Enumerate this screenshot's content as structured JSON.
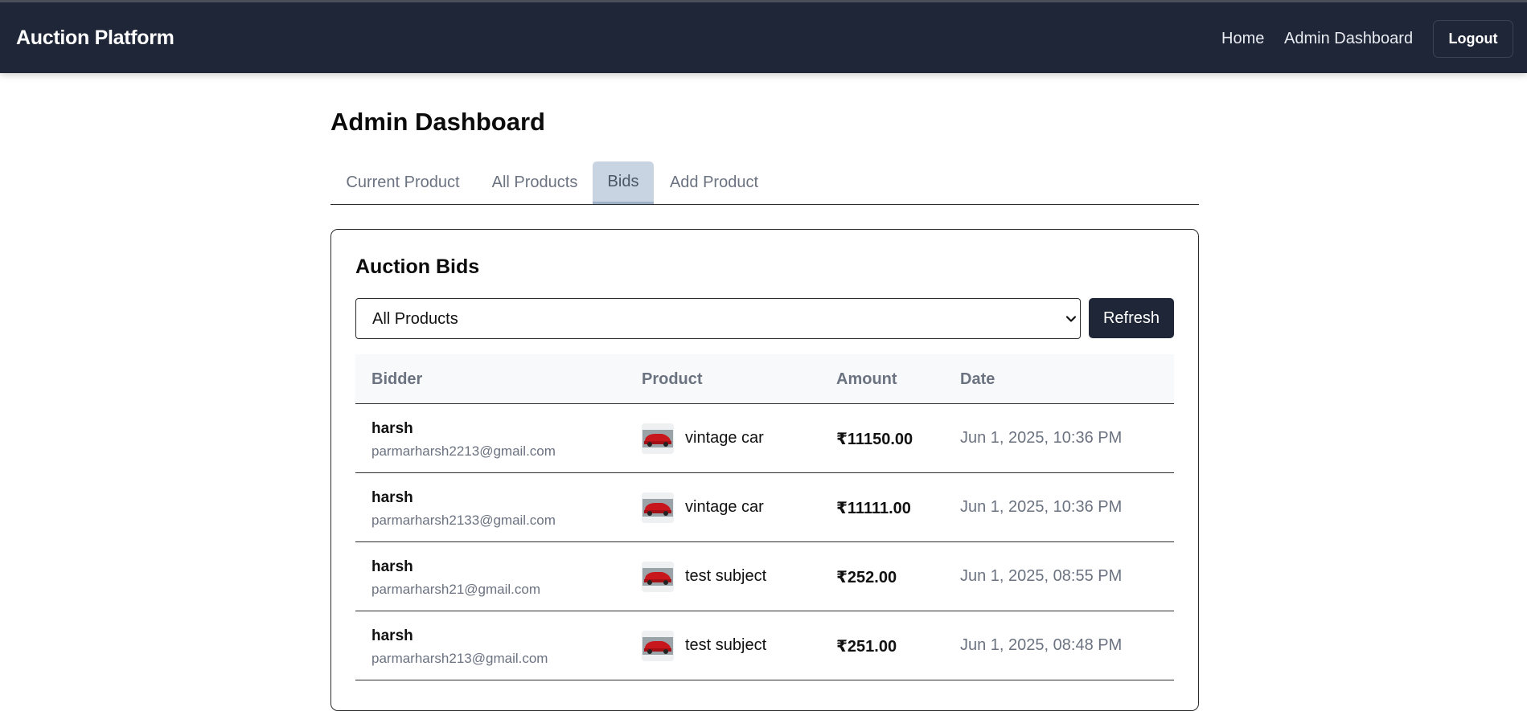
{
  "navbar": {
    "brand": "Auction Platform",
    "links": [
      {
        "label": "Home"
      },
      {
        "label": "Admin Dashboard"
      }
    ],
    "logout_label": "Logout"
  },
  "page": {
    "title": "Admin Dashboard",
    "tabs": [
      {
        "label": "Current Product",
        "active": false
      },
      {
        "label": "All Products",
        "active": false
      },
      {
        "label": "Bids",
        "active": true
      },
      {
        "label": "Add Product",
        "active": false
      }
    ]
  },
  "bids_panel": {
    "title": "Auction Bids",
    "filter": {
      "selected": "All Products"
    },
    "refresh_label": "Refresh",
    "table": {
      "headers": [
        "Bidder",
        "Product",
        "Amount",
        "Date"
      ],
      "rows": [
        {
          "name": "harsh",
          "email": "parmarharsh2213@gmail.com",
          "product": "vintage car",
          "amount": "₹11150.00",
          "date": "Jun 1, 2025, 10:36 PM"
        },
        {
          "name": "harsh",
          "email": "parmarharsh2133@gmail.com",
          "product": "vintage car",
          "amount": "₹11111.00",
          "date": "Jun 1, 2025, 10:36 PM"
        },
        {
          "name": "harsh",
          "email": "parmarharsh21@gmail.com",
          "product": "test subject",
          "amount": "₹252.00",
          "date": "Jun 1, 2025, 08:55 PM"
        },
        {
          "name": "harsh",
          "email": "parmarharsh213@gmail.com",
          "product": "test subject",
          "amount": "₹251.00",
          "date": "Jun 1, 2025, 08:48 PM"
        }
      ]
    }
  },
  "colors": {
    "navbar_bg": "#1f2637",
    "active_tab_bg": "#c9d4e3",
    "muted_text": "#6b7280"
  },
  "icons": {
    "select_chevron": "chevron-down-icon",
    "product_thumbnail": "red-car-thumbnail"
  }
}
